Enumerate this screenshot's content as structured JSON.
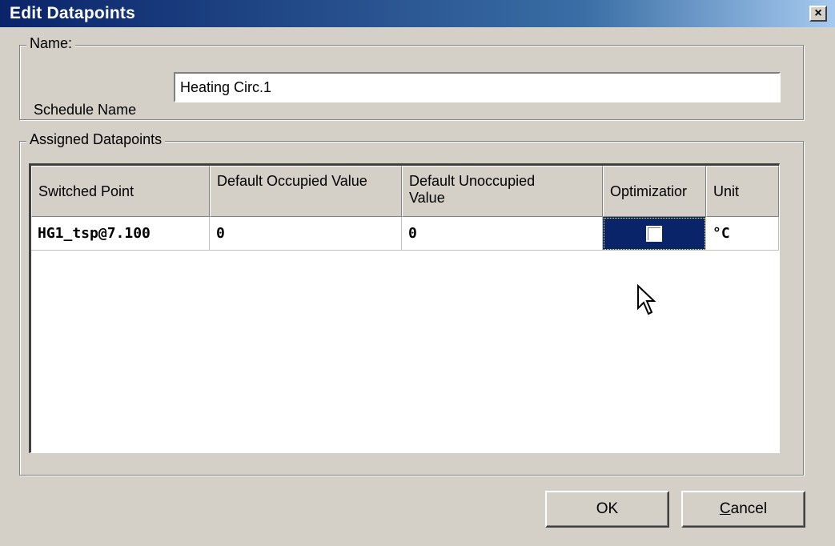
{
  "window": {
    "title": "Edit Datapoints"
  },
  "name_group": {
    "legend": "Name:",
    "schedule_label": "Schedule Name",
    "schedule_value": "Heating Circ.1"
  },
  "datapoints_group": {
    "legend": "Assigned Datapoints",
    "columns": [
      "Switched Point",
      "Default Occupied Value",
      "Default Unoccupied Value",
      "Optimizatior",
      "Unit"
    ],
    "rows": [
      {
        "switched_point": "HG1_tsp@7.100",
        "default_occupied": "0",
        "default_unoccupied": "0",
        "optimization_checked": false,
        "unit": "°C"
      }
    ]
  },
  "buttons": {
    "ok": "OK",
    "cancel_mnemonic": "C",
    "cancel_rest": "ancel"
  },
  "colors": {
    "titlebar_start": "#0a246a",
    "dialog_bg": "#d4d0c8",
    "selection": "#0a246a"
  }
}
